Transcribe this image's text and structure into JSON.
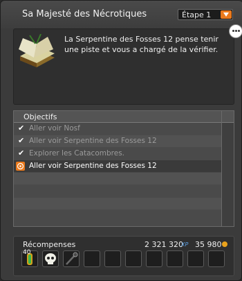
{
  "header": {
    "title": "Sa Majesté des Nécrotiques",
    "step": "Étape 1"
  },
  "description": "La Serpentine des Fosses 12 pense tenir une piste et vous a chargé de la vérifier.",
  "objectives": {
    "title": "Objectifs",
    "items": [
      {
        "label": "Aller voir Nosf",
        "state": "done"
      },
      {
        "label": "Aller voir Serpentine des Fosses 12",
        "state": "done"
      },
      {
        "label": "Explorer les Catacombres.",
        "state": "done"
      },
      {
        "label": "Aller voir Serpentine des Fosses 12",
        "state": "active"
      }
    ]
  },
  "rewards": {
    "title": "Récompenses",
    "xp": "2 321 320",
    "xp_label": "XP",
    "kamas": "35 980",
    "item_count": "40",
    "items": [
      "potion-icon",
      "skull-icon",
      "staff-icon"
    ]
  },
  "colors": {
    "accent": "#e9791c",
    "xp": "#5aa0e6"
  }
}
